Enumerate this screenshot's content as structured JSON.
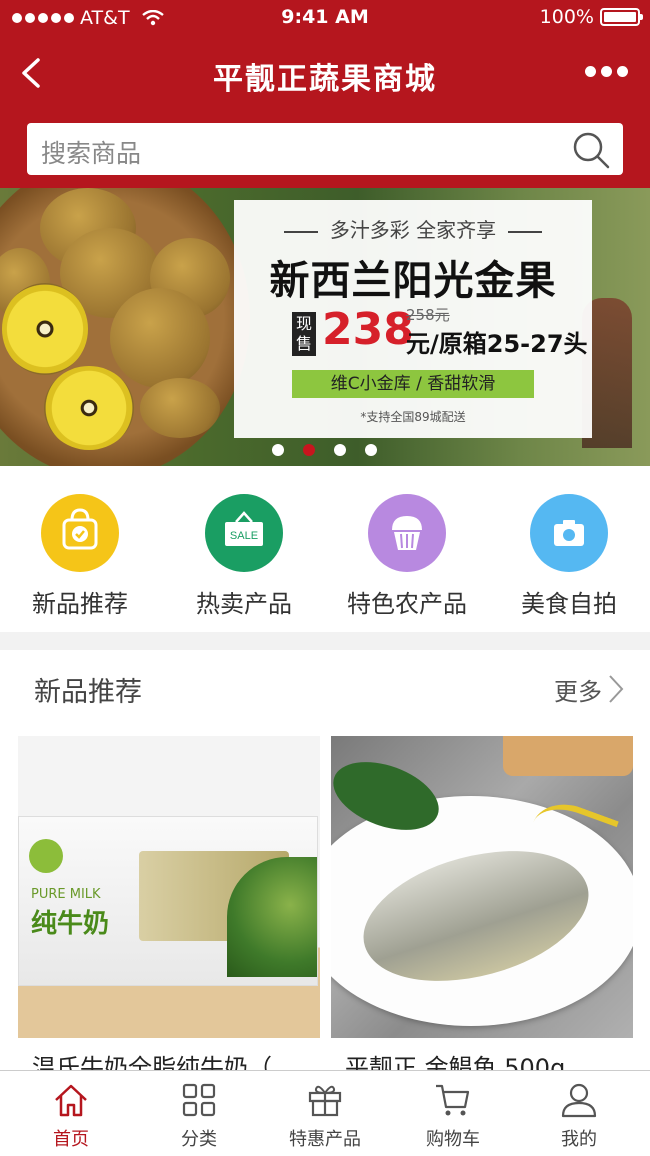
{
  "status_bar": {
    "carrier": "AT&T",
    "time": "9:41 AM",
    "battery": "100%"
  },
  "navbar": {
    "title": "平靓正蔬果商城"
  },
  "search": {
    "placeholder": "搜索商品"
  },
  "banner": {
    "slogan": "多汁多彩 全家齐享",
    "headline": "新西兰阳光金果",
    "ribbon": "现售",
    "price": "238",
    "original_price": "258元",
    "unit": "元/原箱25-27头",
    "tag": "维C小金库 / 香甜软滑",
    "note": "*支持全国89城配送",
    "active_page": 2,
    "page_count": 4
  },
  "categories": [
    {
      "label": "新品推荐",
      "color": "#f5c518",
      "icon": "bag-check-icon"
    },
    {
      "label": "热卖产品",
      "color": "#1a9e63",
      "icon": "sale-sign-icon"
    },
    {
      "label": "特色农产品",
      "color": "#b889e0",
      "icon": "cupcake-icon"
    },
    {
      "label": "美食自拍",
      "color": "#55b8f2",
      "icon": "camera-icon"
    }
  ],
  "section": {
    "title": "新品推荐",
    "more": "更多"
  },
  "products": [
    {
      "name": "温氏牛奶全脂纯牛奶（",
      "image_text_en": "PURE MILK",
      "image_text_cn": "纯牛奶"
    },
    {
      "name": "平靓正 金鲳鱼 500g"
    }
  ],
  "tabbar": [
    {
      "label": "首页",
      "icon": "home-icon",
      "active": true
    },
    {
      "label": "分类",
      "icon": "grid-icon",
      "active": false
    },
    {
      "label": "特惠产品",
      "icon": "gift-icon",
      "active": false
    },
    {
      "label": "购物车",
      "icon": "cart-icon",
      "active": false
    },
    {
      "label": "我的",
      "icon": "user-icon",
      "active": false
    }
  ],
  "colors": {
    "brand": "#b5161e",
    "price": "#d6202a",
    "tag": "#8dc63f"
  }
}
